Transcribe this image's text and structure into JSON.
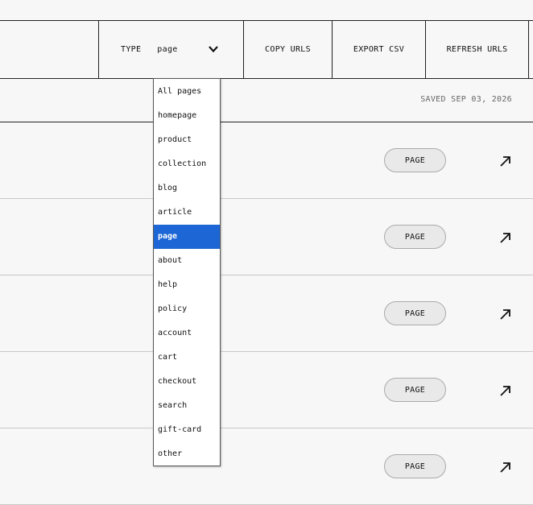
{
  "toolbar": {
    "type_label": "TYPE",
    "type_value": "page",
    "copy_label": "COPY URLS",
    "export_label": "EXPORT CSV",
    "refresh_label": "REFRESH URLS"
  },
  "saved_text": "SAVED SEP 03, 2026",
  "rows": [
    {
      "badge": "PAGE"
    },
    {
      "badge": "PAGE"
    },
    {
      "badge": "PAGE"
    },
    {
      "badge": "PAGE"
    },
    {
      "badge": "PAGE"
    }
  ],
  "dropdown": {
    "selected": "page",
    "selected_color": "#1c66d6",
    "options": [
      "All pages",
      "homepage",
      "product",
      "collection",
      "blog",
      "article",
      "page",
      "about",
      "help",
      "policy",
      "account",
      "cart",
      "checkout",
      "search",
      "gift-card",
      "other"
    ]
  },
  "icons": {
    "chevron": "chevron-down-icon",
    "open": "arrow-up-right-icon"
  }
}
